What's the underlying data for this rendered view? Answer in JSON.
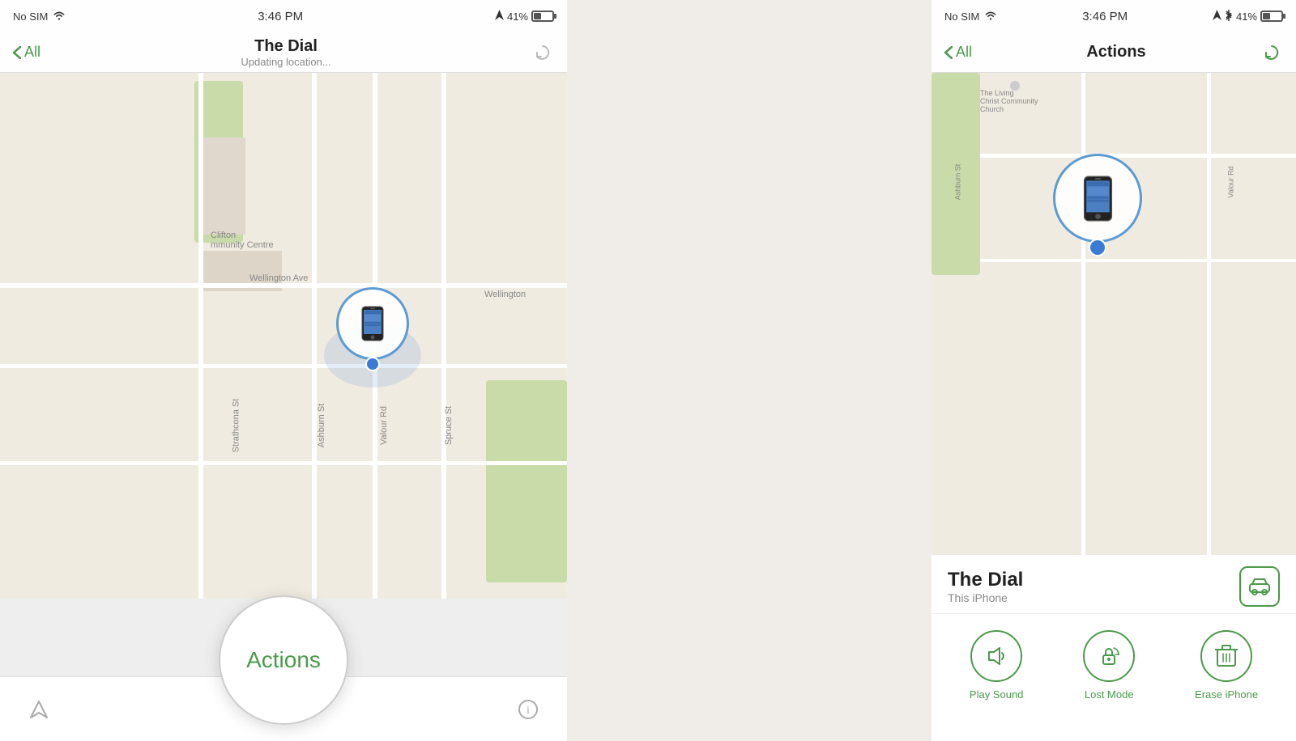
{
  "left": {
    "statusBar": {
      "carrier": "No SIM",
      "wifi": "wifi",
      "time": "3:46 PM",
      "gps": "arrow",
      "battery": "41%"
    },
    "navBar": {
      "backLabel": "All",
      "title": "The Dial",
      "subtitle": "Updating location...",
      "refreshIcon": "refresh"
    },
    "map": {
      "labels": [
        "Clifton",
        "mmunity Centre",
        "Wellington Ave",
        "Wellington",
        "Strathcona St",
        "Ashburn St",
        "Valour Rd",
        "Spruce St",
        "Clifton"
      ]
    },
    "bottomBar": {
      "locationIcon": "location-arrow",
      "actionsLabel": "Actions",
      "infoIcon": "info"
    }
  },
  "right": {
    "statusBar": {
      "carrier": "No SIM",
      "wifi": "wifi",
      "time": "3:46 PM",
      "gps": "arrow",
      "bluetooth": "bluetooth",
      "battery": "41%"
    },
    "navBar": {
      "backLabel": "All",
      "title": "Actions",
      "refreshIcon": "refresh"
    },
    "deviceInfo": {
      "name": "The Dial",
      "subtitle": "This iPhone",
      "directionsIcon": "car"
    },
    "actions": [
      {
        "id": "play-sound",
        "icon": "speaker",
        "label": "Play Sound"
      },
      {
        "id": "lost-mode",
        "icon": "lock-rotate",
        "label": "Lost Mode"
      },
      {
        "id": "erase",
        "icon": "trash",
        "label": "Erase iPhone"
      }
    ]
  }
}
